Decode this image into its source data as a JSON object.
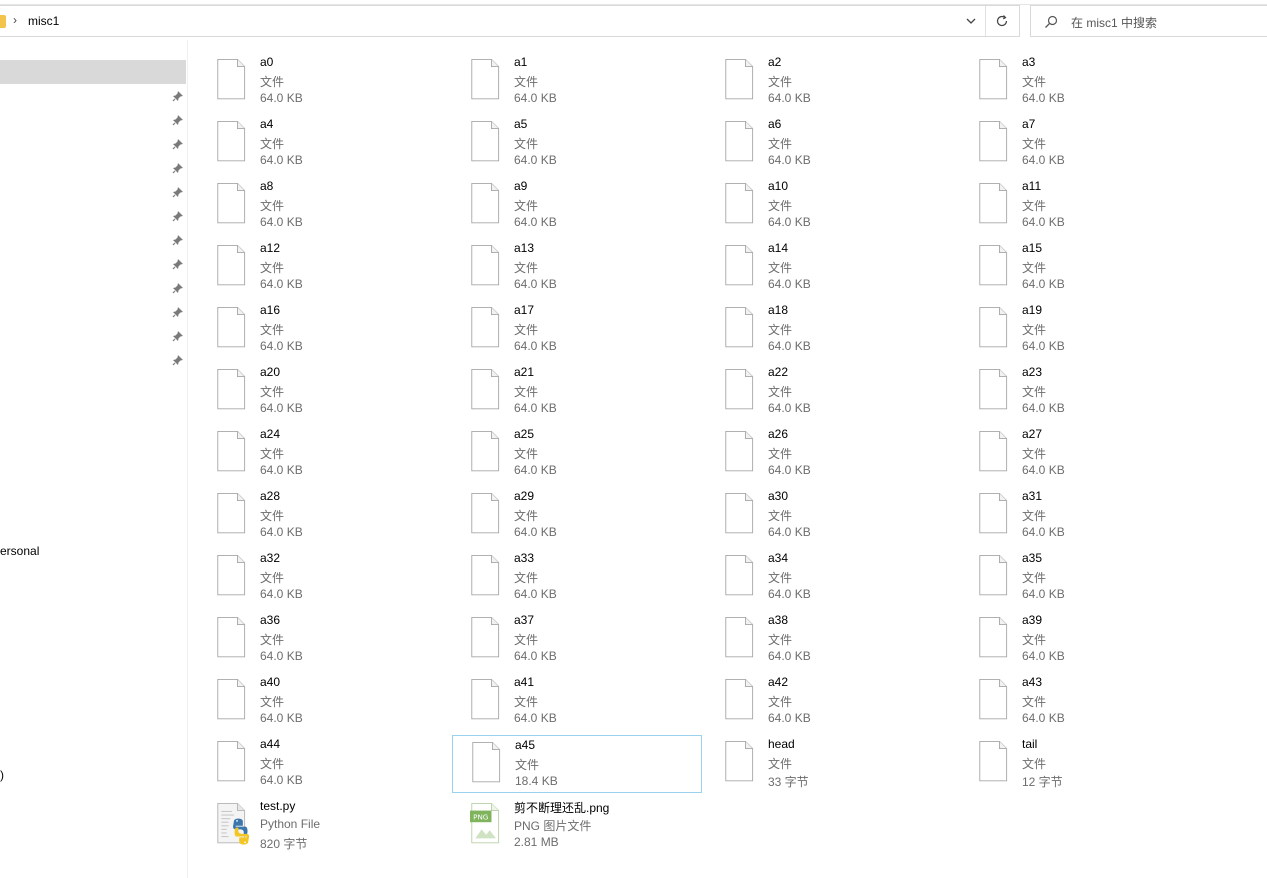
{
  "address_bar": {
    "separator": "›",
    "path": "misc1",
    "search_placeholder": "在 misc1 中搜索"
  },
  "nav_pane": {
    "pinned_count": 12,
    "partial_labels": [
      "ersonal",
      ")"
    ]
  },
  "files": [
    {
      "name": "a0",
      "type": "文件",
      "size": "64.0 KB",
      "icon": "blank-file-icon"
    },
    {
      "name": "a1",
      "type": "文件",
      "size": "64.0 KB",
      "icon": "blank-file-icon"
    },
    {
      "name": "a2",
      "type": "文件",
      "size": "64.0 KB",
      "icon": "blank-file-icon"
    },
    {
      "name": "a3",
      "type": "文件",
      "size": "64.0 KB",
      "icon": "blank-file-icon"
    },
    {
      "name": "a4",
      "type": "文件",
      "size": "64.0 KB",
      "icon": "blank-file-icon"
    },
    {
      "name": "a5",
      "type": "文件",
      "size": "64.0 KB",
      "icon": "blank-file-icon"
    },
    {
      "name": "a6",
      "type": "文件",
      "size": "64.0 KB",
      "icon": "blank-file-icon"
    },
    {
      "name": "a7",
      "type": "文件",
      "size": "64.0 KB",
      "icon": "blank-file-icon"
    },
    {
      "name": "a8",
      "type": "文件",
      "size": "64.0 KB",
      "icon": "blank-file-icon"
    },
    {
      "name": "a9",
      "type": "文件",
      "size": "64.0 KB",
      "icon": "blank-file-icon"
    },
    {
      "name": "a10",
      "type": "文件",
      "size": "64.0 KB",
      "icon": "blank-file-icon"
    },
    {
      "name": "a11",
      "type": "文件",
      "size": "64.0 KB",
      "icon": "blank-file-icon"
    },
    {
      "name": "a12",
      "type": "文件",
      "size": "64.0 KB",
      "icon": "blank-file-icon"
    },
    {
      "name": "a13",
      "type": "文件",
      "size": "64.0 KB",
      "icon": "blank-file-icon"
    },
    {
      "name": "a14",
      "type": "文件",
      "size": "64.0 KB",
      "icon": "blank-file-icon"
    },
    {
      "name": "a15",
      "type": "文件",
      "size": "64.0 KB",
      "icon": "blank-file-icon"
    },
    {
      "name": "a16",
      "type": "文件",
      "size": "64.0 KB",
      "icon": "blank-file-icon"
    },
    {
      "name": "a17",
      "type": "文件",
      "size": "64.0 KB",
      "icon": "blank-file-icon"
    },
    {
      "name": "a18",
      "type": "文件",
      "size": "64.0 KB",
      "icon": "blank-file-icon"
    },
    {
      "name": "a19",
      "type": "文件",
      "size": "64.0 KB",
      "icon": "blank-file-icon"
    },
    {
      "name": "a20",
      "type": "文件",
      "size": "64.0 KB",
      "icon": "blank-file-icon"
    },
    {
      "name": "a21",
      "type": "文件",
      "size": "64.0 KB",
      "icon": "blank-file-icon"
    },
    {
      "name": "a22",
      "type": "文件",
      "size": "64.0 KB",
      "icon": "blank-file-icon"
    },
    {
      "name": "a23",
      "type": "文件",
      "size": "64.0 KB",
      "icon": "blank-file-icon"
    },
    {
      "name": "a24",
      "type": "文件",
      "size": "64.0 KB",
      "icon": "blank-file-icon"
    },
    {
      "name": "a25",
      "type": "文件",
      "size": "64.0 KB",
      "icon": "blank-file-icon"
    },
    {
      "name": "a26",
      "type": "文件",
      "size": "64.0 KB",
      "icon": "blank-file-icon"
    },
    {
      "name": "a27",
      "type": "文件",
      "size": "64.0 KB",
      "icon": "blank-file-icon"
    },
    {
      "name": "a28",
      "type": "文件",
      "size": "64.0 KB",
      "icon": "blank-file-icon"
    },
    {
      "name": "a29",
      "type": "文件",
      "size": "64.0 KB",
      "icon": "blank-file-icon"
    },
    {
      "name": "a30",
      "type": "文件",
      "size": "64.0 KB",
      "icon": "blank-file-icon"
    },
    {
      "name": "a31",
      "type": "文件",
      "size": "64.0 KB",
      "icon": "blank-file-icon"
    },
    {
      "name": "a32",
      "type": "文件",
      "size": "64.0 KB",
      "icon": "blank-file-icon"
    },
    {
      "name": "a33",
      "type": "文件",
      "size": "64.0 KB",
      "icon": "blank-file-icon"
    },
    {
      "name": "a34",
      "type": "文件",
      "size": "64.0 KB",
      "icon": "blank-file-icon"
    },
    {
      "name": "a35",
      "type": "文件",
      "size": "64.0 KB",
      "icon": "blank-file-icon"
    },
    {
      "name": "a36",
      "type": "文件",
      "size": "64.0 KB",
      "icon": "blank-file-icon"
    },
    {
      "name": "a37",
      "type": "文件",
      "size": "64.0 KB",
      "icon": "blank-file-icon"
    },
    {
      "name": "a38",
      "type": "文件",
      "size": "64.0 KB",
      "icon": "blank-file-icon"
    },
    {
      "name": "a39",
      "type": "文件",
      "size": "64.0 KB",
      "icon": "blank-file-icon"
    },
    {
      "name": "a40",
      "type": "文件",
      "size": "64.0 KB",
      "icon": "blank-file-icon"
    },
    {
      "name": "a41",
      "type": "文件",
      "size": "64.0 KB",
      "icon": "blank-file-icon"
    },
    {
      "name": "a42",
      "type": "文件",
      "size": "64.0 KB",
      "icon": "blank-file-icon"
    },
    {
      "name": "a43",
      "type": "文件",
      "size": "64.0 KB",
      "icon": "blank-file-icon"
    },
    {
      "name": "a44",
      "type": "文件",
      "size": "64.0 KB",
      "icon": "blank-file-icon"
    },
    {
      "name": "a45",
      "type": "文件",
      "size": "18.4 KB",
      "icon": "blank-file-icon",
      "selected": true
    },
    {
      "name": "head",
      "type": "文件",
      "size": "33 字节",
      "icon": "blank-file-icon"
    },
    {
      "name": "tail",
      "type": "文件",
      "size": "12 字节",
      "icon": "blank-file-icon"
    },
    {
      "name": "test.py",
      "type": "Python File",
      "size": "820 字节",
      "icon": "python-file-icon"
    },
    {
      "name": "剪不断理还乱.png",
      "type": "PNG 图片文件",
      "size": "2.81 MB",
      "icon": "png-file-icon",
      "badge": "PNG"
    }
  ],
  "colors": {
    "selected_border": "#99d1ee",
    "nav_selected_bg": "#d9d9d9",
    "secondary_text": "#6d6d6d",
    "png_badge": "#7fb35c",
    "python_blue": "#3b76ad",
    "python_yellow": "#f3c623"
  }
}
